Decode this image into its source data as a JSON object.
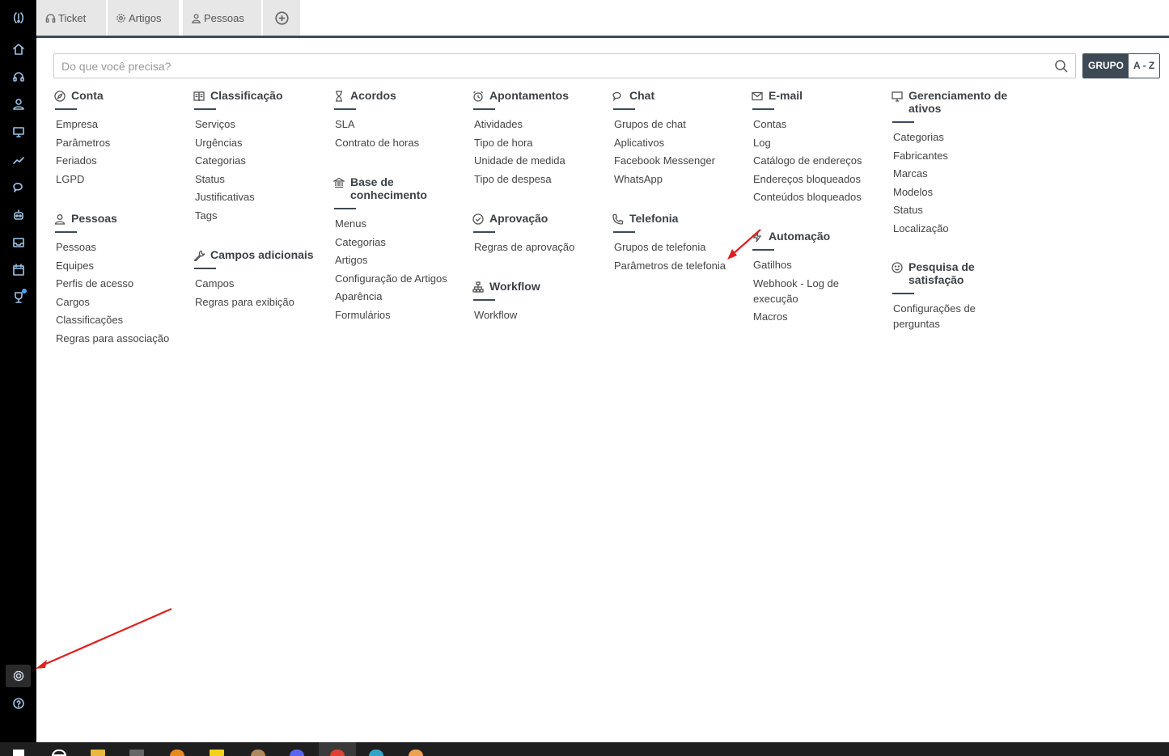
{
  "tabs": [
    {
      "label": "Ticket",
      "icon": "headset-icon"
    },
    {
      "label": "Artigos",
      "icon": "gear-icon"
    },
    {
      "label": "Pessoas",
      "icon": "people-icon"
    }
  ],
  "search": {
    "placeholder": "Do que você precisa?"
  },
  "view_toggle": {
    "grupo": "GRUPO",
    "az": "A - Z"
  },
  "sections": {
    "conta": {
      "title": "Conta",
      "items": [
        "Empresa",
        "Parâmetros",
        "Feriados",
        "LGPD"
      ]
    },
    "pessoas": {
      "title": "Pessoas",
      "items": [
        "Pessoas",
        "Equipes",
        "Perfis de acesso",
        "Cargos",
        "Classificações",
        "Regras para associação"
      ]
    },
    "classificacao": {
      "title": "Classificação",
      "items": [
        "Serviços",
        "Urgências",
        "Categorias",
        "Status",
        "Justificativas",
        "Tags"
      ]
    },
    "campos": {
      "title": "Campos adicionais",
      "items": [
        "Campos",
        "Regras para exibição"
      ]
    },
    "acordos": {
      "title": "Acordos",
      "items": [
        "SLA",
        "Contrato de horas"
      ]
    },
    "base": {
      "title": "Base de conhecimento",
      "items": [
        "Menus",
        "Categorias",
        "Artigos",
        "Configuração de Artigos",
        "Aparência",
        "Formulários"
      ]
    },
    "apontamentos": {
      "title": "Apontamentos",
      "items": [
        "Atividades",
        "Tipo de hora",
        "Unidade de medida",
        "Tipo de despesa"
      ]
    },
    "aprovacao": {
      "title": "Aprovação",
      "items": [
        "Regras de aprovação"
      ]
    },
    "workflow": {
      "title": "Workflow",
      "items": [
        "Workflow"
      ]
    },
    "chat": {
      "title": "Chat",
      "items": [
        "Grupos de chat",
        "Aplicativos",
        "Facebook Messenger",
        "WhatsApp"
      ]
    },
    "telefonia": {
      "title": "Telefonia",
      "items": [
        "Grupos de telefonia",
        "Parâmetros de telefonia"
      ]
    },
    "email": {
      "title": "E-mail",
      "items": [
        "Contas",
        "Log",
        "Catálogo de endereços",
        "Endereços bloqueados",
        "Conteúdos bloqueados"
      ]
    },
    "automacao": {
      "title": "Automação",
      "items": [
        "Gatilhos",
        "Webhook - Log de execução",
        "Macros"
      ]
    },
    "ativos": {
      "title": "Gerenciamento de ativos",
      "items": [
        "Categorias",
        "Fabricantes",
        "Marcas",
        "Modelos",
        "Status",
        "Localização"
      ]
    },
    "pesquisa": {
      "title": "Pesquisa de satisfação",
      "items": [
        "Configurações de perguntas"
      ]
    }
  },
  "sidebar_icons": [
    "logo-icon",
    "home-icon",
    "headset-icon",
    "people-icon",
    "monitor-icon",
    "chart-line-icon",
    "chat-icon",
    "robot-icon",
    "inbox-icon",
    "calendar-icon",
    "trophy-icon",
    "gear-icon",
    "help-icon"
  ],
  "colors": {
    "accent": "#3d4a56",
    "sidebar_bg": "#000000",
    "sidebar_icon": "#9ec2e6",
    "annotation_arrow": "#e02020"
  }
}
